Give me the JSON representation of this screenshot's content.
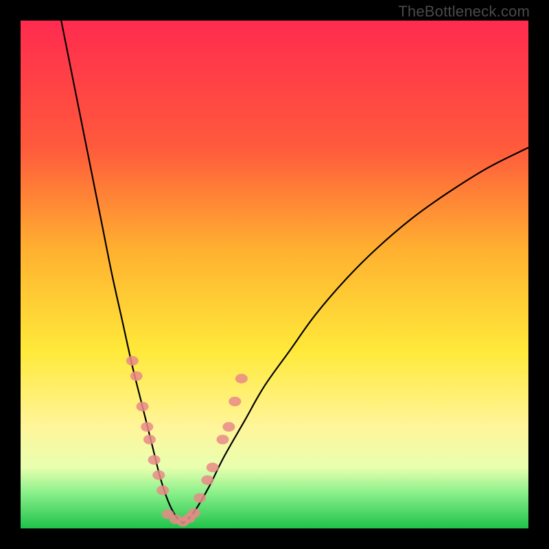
{
  "watermark": "TheBottleneck.com",
  "chart_data": {
    "type": "line",
    "title": "",
    "xlabel": "",
    "ylabel": "",
    "xlim": [
      0,
      100
    ],
    "ylim": [
      0,
      100
    ],
    "gradient": {
      "direction": "top-to-bottom",
      "stops": [
        {
          "pos": 0,
          "color": "#ff2b4f"
        },
        {
          "pos": 25,
          "color": "#ff5a3c"
        },
        {
          "pos": 45,
          "color": "#ffb030"
        },
        {
          "pos": 65,
          "color": "#ffe93a"
        },
        {
          "pos": 80,
          "color": "#fff59a"
        },
        {
          "pos": 88,
          "color": "#e8ffb0"
        },
        {
          "pos": 93,
          "color": "#8af08a"
        },
        {
          "pos": 100,
          "color": "#1ec24a"
        }
      ]
    },
    "series": [
      {
        "name": "left-branch",
        "x": [
          8,
          10,
          12,
          14,
          16,
          18,
          20,
          22,
          24,
          26,
          27.5,
          29,
          30.5,
          32
        ],
        "y": [
          100,
          90,
          80,
          70,
          60,
          50,
          41,
          32,
          24,
          16,
          10,
          5.5,
          2.5,
          1
        ]
      },
      {
        "name": "right-branch",
        "x": [
          32,
          34,
          37,
          40,
          44,
          48,
          53,
          58,
          64,
          70,
          77,
          84,
          92,
          100
        ],
        "y": [
          1,
          3,
          8,
          14,
          21,
          28,
          35,
          42,
          49,
          55,
          61,
          66,
          71,
          75
        ]
      },
      {
        "name": "beads-left",
        "x": [
          22.0,
          22.8,
          24.0,
          24.9,
          25.4,
          26.3,
          27.2,
          28.0
        ],
        "y": [
          33.0,
          30.0,
          24.0,
          20.0,
          17.5,
          13.5,
          10.5,
          7.5
        ]
      },
      {
        "name": "beads-bottom",
        "x": [
          29.0,
          30.5,
          32.0,
          33.2,
          34.2
        ],
        "y": [
          2.8,
          1.8,
          1.3,
          2.0,
          3.0
        ]
      },
      {
        "name": "beads-right",
        "x": [
          35.3,
          36.8,
          37.8,
          39.8,
          41.0,
          42.2,
          43.5
        ],
        "y": [
          6.0,
          9.5,
          12.0,
          17.5,
          20.0,
          25.0,
          29.5
        ]
      }
    ],
    "bead_radius": 9,
    "colors": {
      "curve": "#000000",
      "bead": "#e98a87"
    }
  }
}
